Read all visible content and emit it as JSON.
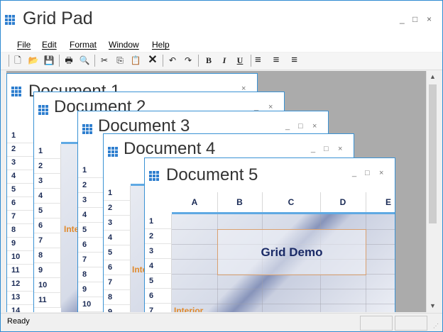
{
  "app": {
    "title": "Grid Pad",
    "min": "_",
    "max": "□",
    "close": "×"
  },
  "menu": [
    "File",
    "Edit",
    "Format",
    "Window",
    "Help"
  ],
  "toolbar": {
    "new_icon": "🗋",
    "open_icon": "📂",
    "save_icon": "💾",
    "print_icon": "🖶",
    "preview_icon": "🔍",
    "cut_icon": "✂",
    "copy_icon": "⎘",
    "paste_icon": "📋",
    "delete_icon": "✕",
    "undo_icon": "↶",
    "redo_icon": "↷",
    "bold": "B",
    "italic": "I",
    "underline": "U",
    "align_left_icon": "≡",
    "align_center_icon": "≡",
    "align_right_icon": "≡"
  },
  "status": {
    "text": "Ready",
    "grip": "⋰"
  },
  "scroll": {
    "up": "▲",
    "down": "▼"
  },
  "doc_controls": {
    "min": "_",
    "max": "□",
    "close": "×"
  },
  "documents": [
    {
      "name": "Document 1",
      "rows": [
        "1",
        "2",
        "3",
        "4",
        "5",
        "6",
        "7",
        "8",
        "9",
        "10",
        "11",
        "12",
        "13",
        "14"
      ]
    },
    {
      "name": "Document 2",
      "rows": [
        "1",
        "2",
        "3",
        "4",
        "5",
        "6",
        "7",
        "8",
        "9",
        "10",
        "11"
      ],
      "interior": "Interior"
    },
    {
      "name": "Document 3",
      "rows": [
        "1",
        "2",
        "3",
        "4",
        "5",
        "6",
        "7",
        "8",
        "9",
        "10"
      ]
    },
    {
      "name": "Document 4",
      "rows": [
        "1",
        "2",
        "3",
        "4",
        "5",
        "6",
        "7",
        "8",
        "9"
      ],
      "interior": "Inter"
    },
    {
      "name": "Document 5",
      "columns": [
        "A",
        "B",
        "C",
        "D",
        "E"
      ],
      "rows": [
        "1",
        "2",
        "3",
        "4",
        "5",
        "6",
        "7"
      ],
      "merged_text": "Grid Demo",
      "interior": "Interior"
    }
  ]
}
